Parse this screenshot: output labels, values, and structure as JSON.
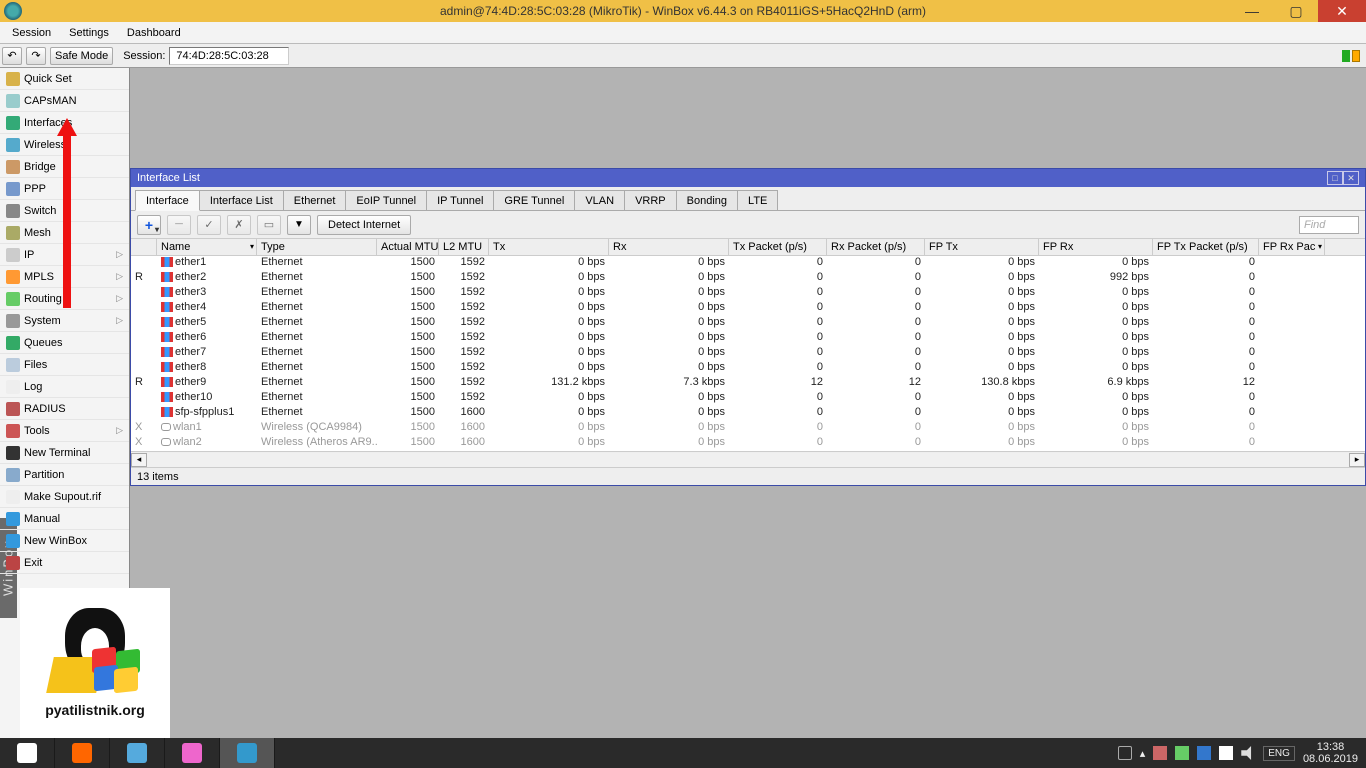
{
  "title": "admin@74:4D:28:5C:03:28 (MikroTik) - WinBox v6.44.3 on RB4011iGS+5HacQ2HnD (arm)",
  "menubar": [
    "Session",
    "Settings",
    "Dashboard"
  ],
  "toolbar": {
    "undo": "↶",
    "redo": "↷",
    "safe_mode": "Safe Mode",
    "session_label": "Session:",
    "session_value": "74:4D:28:5C:03:28"
  },
  "sidebar": {
    "items": [
      {
        "label": "Quick Set",
        "ico": "#d8b24a"
      },
      {
        "label": "CAPsMAN",
        "ico": "#9cc"
      },
      {
        "label": "Interfaces",
        "ico": "#3a7"
      },
      {
        "label": "Wireless",
        "ico": "#5ac"
      },
      {
        "label": "Bridge",
        "ico": "#c96"
      },
      {
        "label": "PPP",
        "ico": "#79c"
      },
      {
        "label": "Switch",
        "ico": "#888"
      },
      {
        "label": "Mesh",
        "ico": "#aa6"
      },
      {
        "label": "IP",
        "ico": "#ccc",
        "sub": true
      },
      {
        "label": "MPLS",
        "ico": "#f93",
        "sub": true
      },
      {
        "label": "Routing",
        "ico": "#6c6",
        "sub": true
      },
      {
        "label": "System",
        "ico": "#999",
        "sub": true
      },
      {
        "label": "Queues",
        "ico": "#3a6"
      },
      {
        "label": "Files",
        "ico": "#bcd"
      },
      {
        "label": "Log",
        "ico": "#eee"
      },
      {
        "label": "RADIUS",
        "ico": "#b55"
      },
      {
        "label": "Tools",
        "ico": "#c55",
        "sub": true
      },
      {
        "label": "New Terminal",
        "ico": "#333"
      },
      {
        "label": "Partition",
        "ico": "#8ac"
      },
      {
        "label": "Make Supout.rif",
        "ico": "#eee"
      },
      {
        "label": "Manual",
        "ico": "#39d"
      },
      {
        "label": "New WinBox",
        "ico": "#39d"
      },
      {
        "label": "Exit",
        "ico": "#b44"
      }
    ],
    "winbox_tab": "WinBox"
  },
  "subwindow": {
    "title": "Interface List",
    "tabs": [
      "Interface",
      "Interface List",
      "Ethernet",
      "EoIP Tunnel",
      "IP Tunnel",
      "GRE Tunnel",
      "VLAN",
      "VRRP",
      "Bonding",
      "LTE"
    ],
    "active_tab": 0,
    "detect_btn": "Detect Internet",
    "find_placeholder": "Find",
    "columns": [
      "",
      "Name",
      "Type",
      "Actual MTU",
      "L2 MTU",
      "Tx",
      "Rx",
      "Tx Packet (p/s)",
      "Rx Packet (p/s)",
      "FP Tx",
      "FP Rx",
      "FP Tx Packet (p/s)",
      "FP Rx Pac"
    ],
    "rows": [
      {
        "flag": "",
        "name": "ether1",
        "type": "Ethernet",
        "amtu": "1500",
        "l2": "1592",
        "tx": "0 bps",
        "rx": "0 bps",
        "txp": "0",
        "rxp": "0",
        "fptx": "0 bps",
        "fprx": "0 bps",
        "fptxp": "0",
        "fprxp": ""
      },
      {
        "flag": "R",
        "name": "ether2",
        "type": "Ethernet",
        "amtu": "1500",
        "l2": "1592",
        "tx": "0 bps",
        "rx": "0 bps",
        "txp": "0",
        "rxp": "0",
        "fptx": "0 bps",
        "fprx": "992 bps",
        "fptxp": "0",
        "fprxp": ""
      },
      {
        "flag": "",
        "name": "ether3",
        "type": "Ethernet",
        "amtu": "1500",
        "l2": "1592",
        "tx": "0 bps",
        "rx": "0 bps",
        "txp": "0",
        "rxp": "0",
        "fptx": "0 bps",
        "fprx": "0 bps",
        "fptxp": "0",
        "fprxp": ""
      },
      {
        "flag": "",
        "name": "ether4",
        "type": "Ethernet",
        "amtu": "1500",
        "l2": "1592",
        "tx": "0 bps",
        "rx": "0 bps",
        "txp": "0",
        "rxp": "0",
        "fptx": "0 bps",
        "fprx": "0 bps",
        "fptxp": "0",
        "fprxp": ""
      },
      {
        "flag": "",
        "name": "ether5",
        "type": "Ethernet",
        "amtu": "1500",
        "l2": "1592",
        "tx": "0 bps",
        "rx": "0 bps",
        "txp": "0",
        "rxp": "0",
        "fptx": "0 bps",
        "fprx": "0 bps",
        "fptxp": "0",
        "fprxp": ""
      },
      {
        "flag": "",
        "name": "ether6",
        "type": "Ethernet",
        "amtu": "1500",
        "l2": "1592",
        "tx": "0 bps",
        "rx": "0 bps",
        "txp": "0",
        "rxp": "0",
        "fptx": "0 bps",
        "fprx": "0 bps",
        "fptxp": "0",
        "fprxp": ""
      },
      {
        "flag": "",
        "name": "ether7",
        "type": "Ethernet",
        "amtu": "1500",
        "l2": "1592",
        "tx": "0 bps",
        "rx": "0 bps",
        "txp": "0",
        "rxp": "0",
        "fptx": "0 bps",
        "fprx": "0 bps",
        "fptxp": "0",
        "fprxp": ""
      },
      {
        "flag": "",
        "name": "ether8",
        "type": "Ethernet",
        "amtu": "1500",
        "l2": "1592",
        "tx": "0 bps",
        "rx": "0 bps",
        "txp": "0",
        "rxp": "0",
        "fptx": "0 bps",
        "fprx": "0 bps",
        "fptxp": "0",
        "fprxp": ""
      },
      {
        "flag": "R",
        "name": "ether9",
        "type": "Ethernet",
        "amtu": "1500",
        "l2": "1592",
        "tx": "131.2 kbps",
        "rx": "7.3 kbps",
        "txp": "12",
        "rxp": "12",
        "fptx": "130.8 kbps",
        "fprx": "6.9 kbps",
        "fptxp": "12",
        "fprxp": ""
      },
      {
        "flag": "",
        "name": "ether10",
        "type": "Ethernet",
        "amtu": "1500",
        "l2": "1592",
        "tx": "0 bps",
        "rx": "0 bps",
        "txp": "0",
        "rxp": "0",
        "fptx": "0 bps",
        "fprx": "0 bps",
        "fptxp": "0",
        "fprxp": ""
      },
      {
        "flag": "",
        "name": "sfp-sfpplus1",
        "type": "Ethernet",
        "amtu": "1500",
        "l2": "1600",
        "tx": "0 bps",
        "rx": "0 bps",
        "txp": "0",
        "rxp": "0",
        "fptx": "0 bps",
        "fprx": "0 bps",
        "fptxp": "0",
        "fprxp": ""
      },
      {
        "flag": "X",
        "name": "wlan1",
        "type": "Wireless (QCA9984)",
        "amtu": "1500",
        "l2": "1600",
        "tx": "0 bps",
        "rx": "0 bps",
        "txp": "0",
        "rxp": "0",
        "fptx": "0 bps",
        "fprx": "0 bps",
        "fptxp": "0",
        "fprxp": "",
        "disabled": true,
        "wl": true
      },
      {
        "flag": "X",
        "name": "wlan2",
        "type": "Wireless (Atheros AR9...",
        "amtu": "1500",
        "l2": "1600",
        "tx": "0 bps",
        "rx": "0 bps",
        "txp": "0",
        "rxp": "0",
        "fptx": "0 bps",
        "fprx": "0 bps",
        "fptxp": "0",
        "fprxp": "",
        "disabled": true,
        "wl": true
      }
    ],
    "status": "13 items"
  },
  "taskbar": {
    "icons": [
      {
        "name": "chrome",
        "c": "#fff"
      },
      {
        "name": "firefox",
        "c": "#f60"
      },
      {
        "name": "notepad",
        "c": "#5ad"
      },
      {
        "name": "paint",
        "c": "#e6c"
      },
      {
        "name": "winbox",
        "c": "#39c",
        "active": true
      }
    ],
    "lang": "ENG",
    "time": "13:38",
    "date": "08.06.2019"
  },
  "logo_text": "pyatilistnik.org"
}
